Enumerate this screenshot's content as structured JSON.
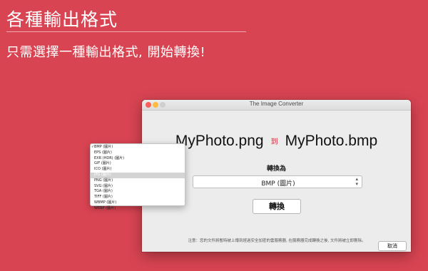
{
  "promo": {
    "headline": "各種輸出格式",
    "tagline": "只需選擇一種輸出格式, 開始轉換!"
  },
  "window": {
    "title": "The Image Converter",
    "source_file": "MyPhoto.png",
    "to_word": "到",
    "target_file": "MyPhoto.bmp",
    "convert_to_label": "轉換為",
    "selected_format": "BMP (圖片)",
    "convert_button": "轉換",
    "notice": "注意：您的文件將暫時被上傳到經過安全加密的雲服務器, 在服務器完成轉換之後, 文件將被立即刪除。",
    "cancel_button": "取消"
  },
  "dropdown": {
    "checkmark": "✓",
    "items": [
      "BMP (圖片)",
      "EPS (圖片)",
      "EXR (HDR) (圖片)",
      "GIF (圖片)",
      "ICO (圖片)",
      "JPG (圖片)",
      "PNG (圖片)",
      "SVG (圖片)",
      "TGA (圖片)",
      "TIFF (圖片)",
      "WBMP (圖片)",
      "WEBP (圖片)"
    ],
    "selected_index": 0,
    "highlighted_index": 5
  },
  "colors": {
    "background": "#d94452",
    "accent_red": "#d0293b",
    "window_bg": "#ececec"
  }
}
